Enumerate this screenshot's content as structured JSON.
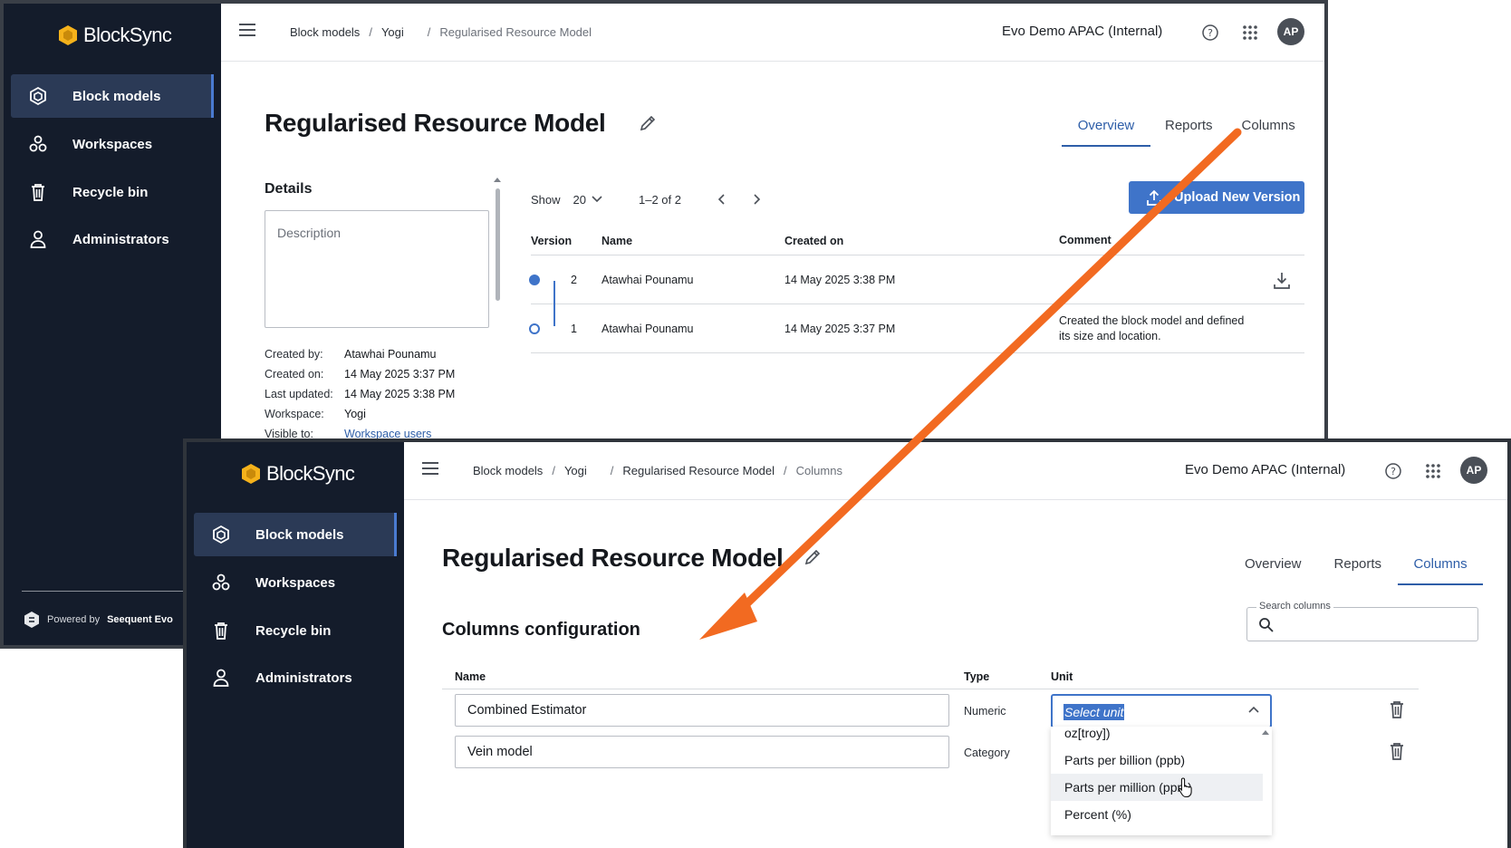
{
  "app": {
    "brand": "BlockSync",
    "powered_by_prefix": "Powered by",
    "powered_by_name": "Seequent Evo"
  },
  "sidebar": {
    "items": [
      {
        "label": "Block models",
        "icon": "cube-icon",
        "active": true
      },
      {
        "label": "Workspaces",
        "icon": "workspaces-icon"
      },
      {
        "label": "Recycle bin",
        "icon": "trash-icon"
      },
      {
        "label": "Administrators",
        "icon": "person-icon"
      }
    ]
  },
  "header": {
    "org": "Evo Demo APAC (Internal)",
    "avatar": "AP"
  },
  "overview_screen": {
    "breadcrumbs": [
      "Block models",
      "Yogi",
      "Regularised Resource Model"
    ],
    "title": "Regularised Resource Model",
    "tabs": [
      "Overview",
      "Reports",
      "Columns"
    ],
    "active_tab": "Overview",
    "details": {
      "heading": "Details",
      "description_placeholder": "Description",
      "fields": [
        {
          "key": "Created by:",
          "value": "Atawhai Pounamu"
        },
        {
          "key": "Created on:",
          "value": "14 May 2025 3:37 PM"
        },
        {
          "key": "Last updated:",
          "value": "14 May 2025 3:38 PM"
        },
        {
          "key": "Workspace:",
          "value": "Yogi"
        },
        {
          "key": "Visible to:",
          "value": "Workspace users",
          "link": true
        }
      ]
    },
    "pager": {
      "show_label": "Show",
      "page_size": "20",
      "range": "1–2 of 2"
    },
    "upload_button": "Upload New Version",
    "versions_table": {
      "headers": [
        "Version",
        "Name",
        "Created on",
        "Comment"
      ],
      "rows": [
        {
          "version": "2",
          "name": "Atawhai Pounamu",
          "created_on": "14 May 2025 3:38 PM",
          "comment": ""
        },
        {
          "version": "1",
          "name": "Atawhai Pounamu",
          "created_on": "14 May 2025 3:37 PM",
          "comment": "Created the block model and defined its size and location."
        }
      ]
    }
  },
  "columns_screen": {
    "breadcrumbs": [
      "Block models",
      "Yogi",
      "Regularised Resource Model",
      "Columns"
    ],
    "title": "Regularised Resource Model",
    "tabs": [
      "Overview",
      "Reports",
      "Columns"
    ],
    "active_tab": "Columns",
    "section_title": "Columns configuration",
    "search": {
      "label": "Search columns",
      "value": ""
    },
    "table": {
      "headers": [
        "Name",
        "Type",
        "Unit"
      ],
      "rows": [
        {
          "name": "Combined Estimator",
          "type": "Numeric",
          "unit_placeholder": "Select unit"
        },
        {
          "name": "Vein model",
          "type": "Category"
        }
      ]
    },
    "unit_dropdown": {
      "options": [
        "oz[troy])",
        "Parts per billion (ppb)",
        "Parts per million (ppm)",
        "Percent (%)"
      ],
      "hovered": "Parts per million (ppm)"
    }
  },
  "colors": {
    "sidebar_bg": "#141c2b",
    "accent": "#3f74c9",
    "annotation_arrow": "#f26a21"
  }
}
